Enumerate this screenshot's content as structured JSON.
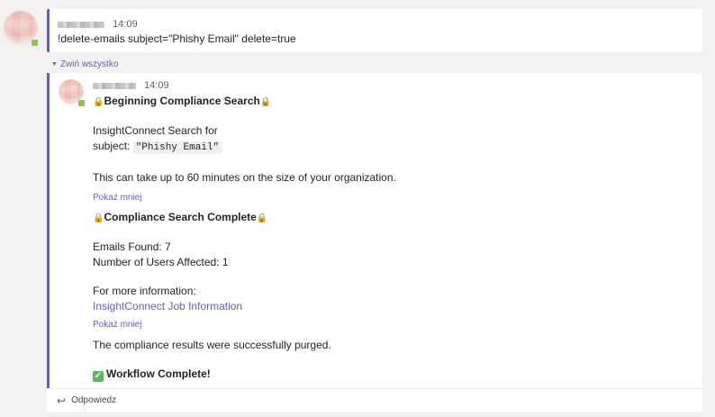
{
  "root_message": {
    "time": "14:09",
    "text": "!delete-emails subject=\"Phishy Email\" delete=true"
  },
  "thread": {
    "collapse_label": "Zwiń wszystko"
  },
  "reply": {
    "time": "14:09",
    "beginning_title": "Beginning Compliance Search",
    "search_for": "InsightConnect Search for",
    "subject_label": "subject:",
    "subject_value": "\"Phishy Email\"",
    "duration_note": "This can take up to 60 minutes on the size of your organization.",
    "show_less_1": "Pokaż mniej",
    "complete_title": "Compliance Search Complete",
    "emails_found": "Emails Found: 7",
    "users_affected": "Number of Users Affected: 1",
    "more_info": "For more information:",
    "job_link": "InsightConnect Job Information",
    "show_less_2": "Pokaż mniej",
    "purged": "The compliance results were successfully purged.",
    "workflow_complete": "Workflow Complete!"
  },
  "reply_bar": {
    "label": "Odpowiedz"
  },
  "icons": {
    "lock": "🔒",
    "check": "✓",
    "reply_arrow": "↩",
    "collapse_triangle": "▼"
  },
  "colors": {
    "accent": "#6264a7",
    "presence": "#92c353",
    "check_green": "#5cb85c"
  }
}
